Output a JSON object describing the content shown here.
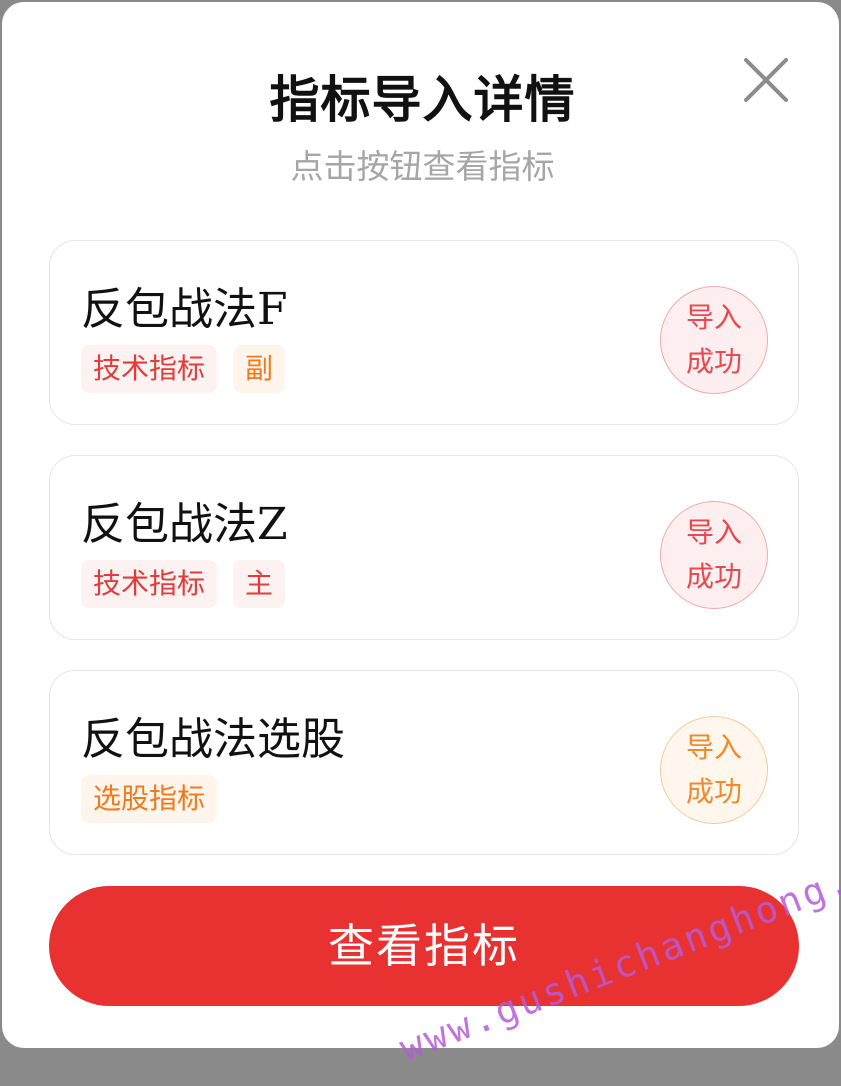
{
  "dialog": {
    "title": "指标导入详情",
    "subtitle": "点击按钮查看指标",
    "close_icon": "close-icon"
  },
  "indicators": [
    {
      "name": "反包战法F",
      "tags": [
        {
          "label": "技术指标",
          "color": "#e33a3a"
        },
        {
          "label": "副",
          "color": "#f07a1c"
        }
      ],
      "status": {
        "line1": "导入",
        "line2": "成功",
        "color": "#e6494f"
      }
    },
    {
      "name": "反包战法Z",
      "tags": [
        {
          "label": "技术指标",
          "color": "#e33a3a"
        },
        {
          "label": "主",
          "color": "#e33a3a"
        }
      ],
      "status": {
        "line1": "导入",
        "line2": "成功",
        "color": "#e6494f"
      }
    },
    {
      "name": "反包战法选股",
      "tags": [
        {
          "label": "选股指标",
          "color": "#f07a1c"
        }
      ],
      "status": {
        "line1": "导入",
        "line2": "成功",
        "color": "#f08a2a"
      }
    }
  ],
  "primary_button": {
    "label": "查看指标",
    "color": "#e83131"
  },
  "watermark": "www.gushichanghong.com"
}
